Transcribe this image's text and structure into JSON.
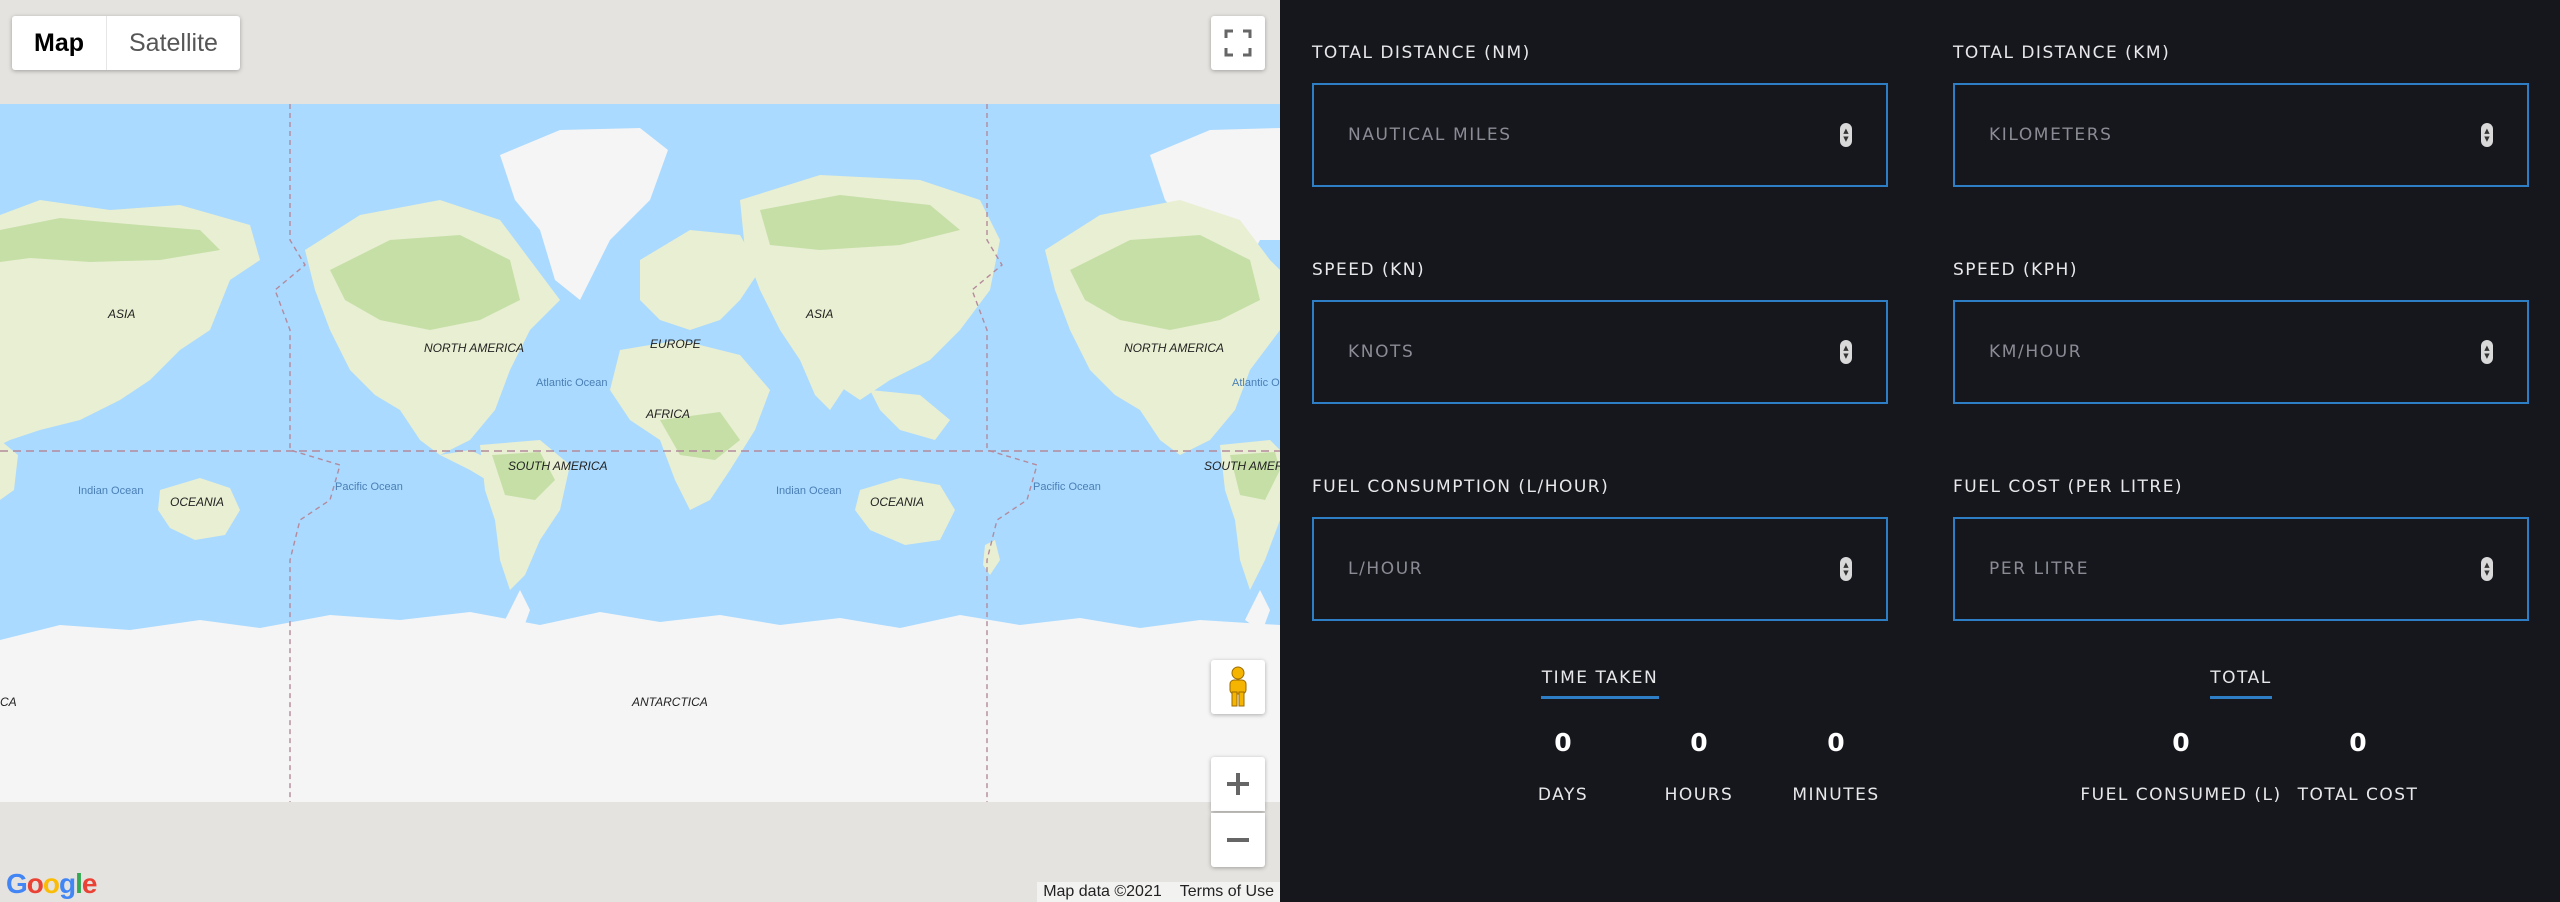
{
  "map": {
    "type_buttons": [
      "Map",
      "Satellite"
    ],
    "active_type": "Map",
    "labels": {
      "asia_left": "ASIA",
      "north_america": "NORTH AMERICA",
      "atlantic": "Atlantic Ocean",
      "europe": "EUROPE",
      "asia_center": "ASIA",
      "africa": "AFRICA",
      "south_america": "SOUTH AMERICA",
      "indian_left": "Indian Ocean",
      "oceania_left": "OCEANIA",
      "pacific_left": "Pacific Ocean",
      "indian_right": "Indian Ocean",
      "oceania_right": "OCEANIA",
      "pacific_right": "Pacific Ocean",
      "north_america_right": "NORTH AMERICA",
      "atlantic_right": "Atlantic Ocean",
      "south_america_right": "SOUTH AMERICA",
      "antarctica": "ANTARCTICA",
      "antarctica_edge": "CA"
    },
    "google_logo": "Google",
    "attribution": "Map data ©2021",
    "terms": "Terms of Use",
    "icons": [
      "fullscreen-icon",
      "pegman-icon",
      "zoom-in-icon",
      "zoom-out-icon"
    ]
  },
  "calculator": {
    "fields": [
      {
        "label": "TOTAL DISTANCE (NM)",
        "placeholder": "NAUTICAL MILES"
      },
      {
        "label": "TOTAL DISTANCE (KM)",
        "placeholder": "KILOMETERS"
      },
      {
        "label": "SPEED (KN)",
        "placeholder": "KNOTS"
      },
      {
        "label": "SPEED (KPH)",
        "placeholder": "KM/HOUR"
      },
      {
        "label": "FUEL CONSUMPTION (L/HOUR)",
        "placeholder": "L/HOUR"
      },
      {
        "label": "FUEL COST (PER LITRE)",
        "placeholder": "PER LITRE"
      }
    ],
    "time_taken": {
      "title": "TIME TAKEN",
      "days": {
        "value": "0",
        "label": "DAYS"
      },
      "hours": {
        "value": "0",
        "label": "HOURS"
      },
      "minutes": {
        "value": "0",
        "label": "MINUTES"
      }
    },
    "total": {
      "title": "TOTAL",
      "fuel_consumed": {
        "value": "0",
        "label": "FUEL CONSUMED (L)"
      },
      "total_cost": {
        "value": "0",
        "label": "TOTAL COST"
      }
    }
  },
  "colors": {
    "ocean": "#aadaff",
    "land": "#e9efd2",
    "forest": "#c5dfa7",
    "ice": "#f5f5f5",
    "panel_bg": "#16171d",
    "accent": "#2d7ec4"
  }
}
